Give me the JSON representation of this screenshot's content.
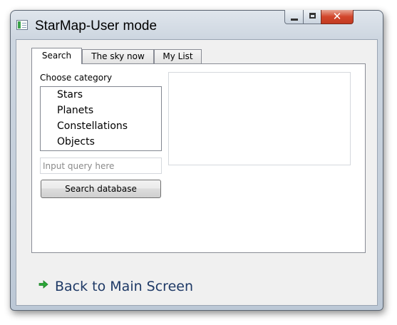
{
  "window": {
    "title": "StarMap-User mode",
    "controls": {
      "minimize_icon": "minimize-icon",
      "maximize_icon": "maximize-icon",
      "close_glyph": "✕"
    }
  },
  "tabs": [
    {
      "label": "Search",
      "active": true
    },
    {
      "label": "The sky now",
      "active": false
    },
    {
      "label": "My List",
      "active": false
    }
  ],
  "search": {
    "category_label": "Choose category",
    "categories": [
      "Stars",
      "Planets",
      "Constellations",
      "Objects"
    ],
    "query_placeholder": "Input query here",
    "query_value": "",
    "button_label": "Search database"
  },
  "footer": {
    "back_label": "Back to Main Screen",
    "back_icon": "green-arrow-right-icon"
  },
  "colors": {
    "close_button": "#d2452b",
    "link_text": "#1e3966",
    "arrow": "#2aa836"
  }
}
